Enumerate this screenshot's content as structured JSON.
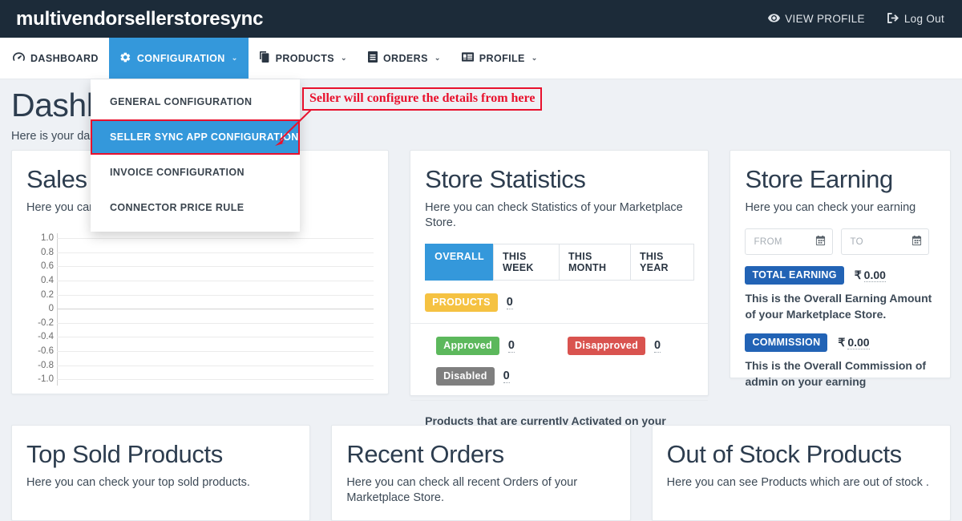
{
  "topbar": {
    "brand": "multivendorsellerstoresync",
    "view_profile": "VIEW PROFILE",
    "log_out": "Log Out"
  },
  "nav": {
    "items": [
      {
        "label": "DASHBOARD",
        "icon": "dashboard-icon",
        "caret": "",
        "active": false
      },
      {
        "label": "CONFIGURATION",
        "icon": "gear-icon",
        "caret": "⌄",
        "active": true
      },
      {
        "label": "PRODUCTS",
        "icon": "copy-icon",
        "caret": "⌄",
        "active": false
      },
      {
        "label": "ORDERS",
        "icon": "list-icon",
        "caret": "⌄",
        "active": false
      },
      {
        "label": "PROFILE",
        "icon": "id-card-icon",
        "caret": "⌄",
        "active": false
      }
    ]
  },
  "dropdown": {
    "items": [
      {
        "label": "GENERAL CONFIGURATION",
        "selected": false
      },
      {
        "label": "SELLER SYNC APP CONFIGURATION",
        "selected": true
      },
      {
        "label": "INVOICE CONFIGURATION",
        "selected": false
      },
      {
        "label": "CONNECTOR PRICE RULE",
        "selected": false
      }
    ]
  },
  "annotation": {
    "text": "Seller will configure the details from here",
    "color": "#e8112d"
  },
  "page": {
    "title": "Dashboard",
    "subtitle": "Here is your dashboard"
  },
  "sales": {
    "title": "Sales",
    "desc": "Here you can see your sales"
  },
  "chart_data": {
    "type": "line",
    "title": "Sales",
    "xlabel": "",
    "ylabel": "",
    "ylim": [
      -1.0,
      1.0
    ],
    "yticks": [
      "1.0",
      "0.8",
      "0.6",
      "0.4",
      "0.2",
      "0",
      "-0.2",
      "-0.4",
      "-0.6",
      "-0.8",
      "-1.0"
    ],
    "x": [],
    "series": [
      {
        "name": "Sales",
        "values": []
      }
    ],
    "grid": true,
    "legend": "none"
  },
  "stats": {
    "title": "Store Statistics",
    "desc": "Here you can check Statistics of your Marketplace Store.",
    "tabs": [
      {
        "label": "OVERALL",
        "active": true
      },
      {
        "label": "THIS WEEK",
        "active": false
      },
      {
        "label": "THIS MONTH",
        "active": false
      },
      {
        "label": "THIS YEAR",
        "active": false
      }
    ],
    "products_label": "PRODUCTS",
    "products_count": "0",
    "approved_label": "Approved",
    "approved_count": "0",
    "disapproved_label": "Disapproved",
    "disapproved_count": "0",
    "disabled_label": "Disabled",
    "disabled_count": "0",
    "footer": "Products that are currently Activated on your Marketplace Store."
  },
  "earning": {
    "title": "Store Earning",
    "desc": "Here you can check your earning",
    "from_placeholder": "FROM",
    "to_placeholder": "TO",
    "total_label": "TOTAL EARNING",
    "total_currency": "₹",
    "total_value": "0.00",
    "total_note": "This is the Overall Earning Amount of your Marketplace Store.",
    "commission_label": "COMMISSION",
    "commission_currency": "₹",
    "commission_value": "0.00",
    "commission_note": "This is the Overall Commission of admin on your earning"
  },
  "bottom": [
    {
      "title": "Top Sold Products",
      "desc": "Here you can check your top sold products."
    },
    {
      "title": "Recent Orders",
      "desc": "Here you can check all recent Orders of your Marketplace Store."
    },
    {
      "title": "Out of Stock Products",
      "desc": "Here you can see Products which are out of stock ."
    }
  ],
  "colors": {
    "header_bg": "#1c2b39",
    "accent_blue": "#3498db",
    "annotation_red": "#e8112d",
    "yellow": "#f5c242",
    "green": "#5cb85c",
    "red": "#d9534f",
    "gray": "#7f7f7f",
    "dark_blue": "#2263b5"
  }
}
